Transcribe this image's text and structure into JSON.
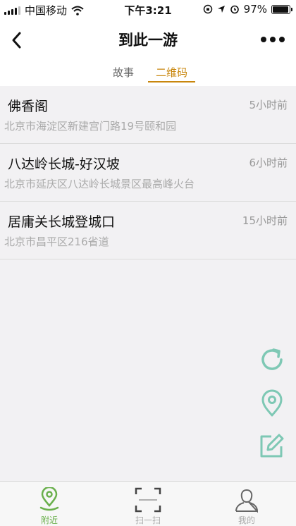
{
  "status_bar": {
    "carrier": "中国移动",
    "time": "下午3:21",
    "battery": "97%",
    "battery_level": 0.97
  },
  "nav": {
    "title": "到此一游"
  },
  "tabs": [
    {
      "label": "故事"
    },
    {
      "label": "二维码"
    }
  ],
  "places": [
    {
      "name": "佛香阁",
      "time": "5小时前",
      "address": "北京市海淀区新建宫门路19号颐和园"
    },
    {
      "name": "八达岭长城-好汉坡",
      "time": "6小时前",
      "address": "北京市延庆区八达岭长城景区最高峰火台"
    },
    {
      "name": "居庸关长城登城口",
      "time": "15小时前",
      "address": "北京市昌平区216省道"
    }
  ],
  "fab_icons": [
    "refresh-icon",
    "location-pin-icon",
    "edit-icon"
  ],
  "bottom_tabs": [
    {
      "label": "附近",
      "icon": "location-pin-icon"
    },
    {
      "label": "扫一扫",
      "icon": "scan-icon"
    },
    {
      "label": "我的",
      "icon": "user-icon"
    }
  ],
  "colors": {
    "accent": "#c8860c",
    "fab": "#7ec8b4",
    "tab_active": "#6ab04c"
  }
}
